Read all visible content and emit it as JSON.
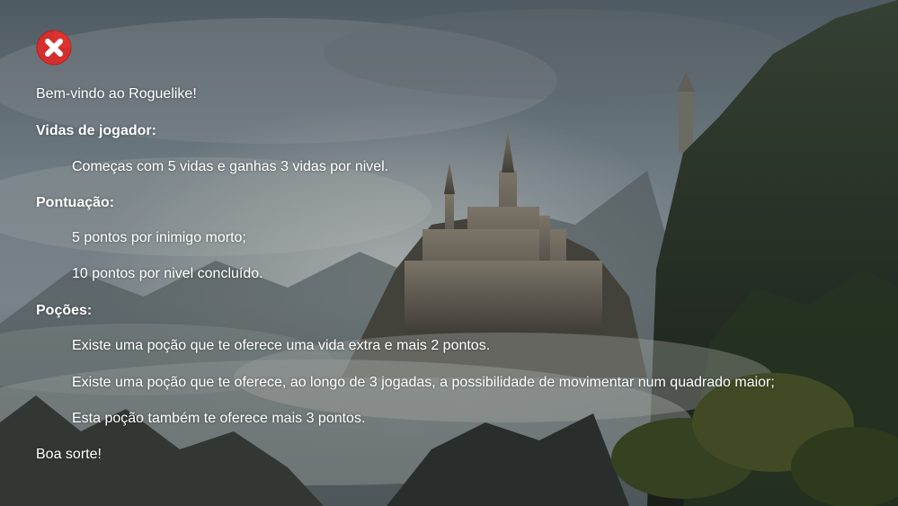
{
  "intro": "Bem-vindo ao Roguelike!",
  "sections": {
    "lives": {
      "heading": "Vidas de jogador:",
      "items": [
        "Começas com 5 vidas e ganhas 3 vidas por nivel."
      ]
    },
    "score": {
      "heading": "Pontuação:",
      "items": [
        "5 pontos por inimigo morto;",
        "10 pontos por nivel concluído."
      ]
    },
    "potions": {
      "heading": "Poções:",
      "items": [
        "Existe uma poção que te oferece uma vida extra e mais 2 pontos.",
        "Existe uma poção que te oferece, ao longo de 3 jogadas, a possibilidade de movimentar num quadrado maior;",
        "Esta poção também te oferece mais 3 pontos."
      ]
    }
  },
  "outro": "Boa sorte!",
  "close_icon": "close-x-icon",
  "colors": {
    "text": "#ffffff",
    "close_red": "#d32f2f"
  }
}
